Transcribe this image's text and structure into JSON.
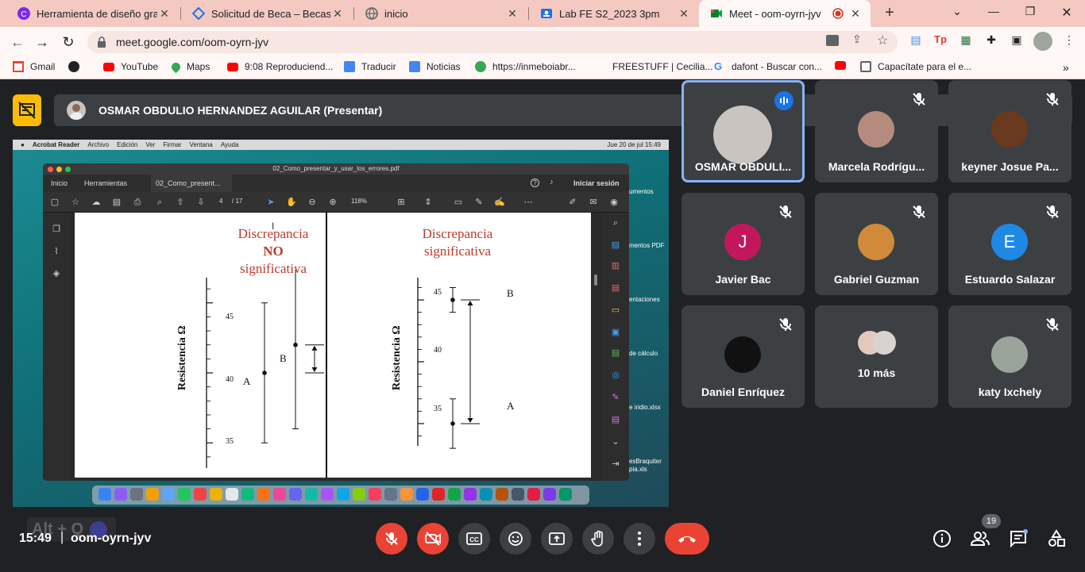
{
  "browser": {
    "tabs": [
      {
        "title": "Herramienta de diseño gratu",
        "icon": "canva-icon",
        "color": "#7d2ae8"
      },
      {
        "title": "Solicitud de Beca – Becas US",
        "icon": "diamond-icon",
        "color": "#1a73e8"
      },
      {
        "title": "inicio",
        "icon": "globe-icon",
        "color": "#5f6368"
      },
      {
        "title": "Lab FE S2_2023 3pm",
        "icon": "classroom-icon",
        "color": "#1a73e8"
      },
      {
        "title": "Meet - oom-oyrn-jyv",
        "icon": "meet-icon",
        "color": "#00832d",
        "active": true
      }
    ],
    "url": "meet.google.com/oom-oyrn-jyv",
    "bookmarks": [
      {
        "label": "Gmail",
        "icon": "gmail-icon",
        "color": "#ea4335"
      },
      {
        "label": "",
        "icon": "github-icon",
        "color": "#222"
      },
      {
        "label": "YouTube",
        "icon": "youtube-icon",
        "color": "#ff0000"
      },
      {
        "label": "Maps",
        "icon": "maps-icon",
        "color": "#34a853"
      },
      {
        "label": "9:08 Reproduciend...",
        "icon": "youtube-icon",
        "color": "#ff0000"
      },
      {
        "label": "Traducir",
        "icon": "translate-icon",
        "color": "#4285f4"
      },
      {
        "label": "Noticias",
        "icon": "news-icon",
        "color": "#4285f4"
      },
      {
        "label": "https://inmeboiabr...",
        "icon": "globe-icon",
        "color": "#34a853"
      },
      {
        "label": "FREESTUFF | Cecilia...",
        "icon": "",
        "color": "#fff7f5"
      },
      {
        "label": "dafont - Buscar con...",
        "icon": "google-icon",
        "color": "#4285f4"
      },
      {
        "label": "",
        "icon": "youtube-icon",
        "color": "#ff0000"
      },
      {
        "label": "Capacítate para el e...",
        "icon": "edit-icon",
        "color": "#5f6368"
      }
    ],
    "bookmarks_more": "»"
  },
  "meet": {
    "presenter": "OSMAR OBDULIO HERNANDEZ AGUILAR (Presentar)",
    "time": "15:49",
    "separator": "|",
    "code": "oom-oyrn-jyv",
    "shortcut_hint": "Alt + Q",
    "participants_count": "19",
    "participants": [
      {
        "name": "OSMAR OBDULI...",
        "speaking": true,
        "avatar": "photo",
        "color": "#c9c4bf"
      },
      {
        "name": "Marcela Rodrígu...",
        "avatar": "photo",
        "color": "#b58b7e"
      },
      {
        "name": "keyner Josue Pa...",
        "avatar": "photo",
        "color": "#6a3a1e"
      },
      {
        "name": "Javier Bac",
        "avatar": "J",
        "color": "#c2185b"
      },
      {
        "name": "Gabriel Guzman",
        "avatar": "photo",
        "color": "#d08a3a"
      },
      {
        "name": "Estuardo Salazar",
        "avatar": "E",
        "color": "#1e88e5"
      },
      {
        "name": "Daniel Enríquez",
        "avatar": "photo",
        "color": "#111"
      },
      {
        "name": "10 más",
        "avatar": "group",
        "color": "#c9a7a0"
      },
      {
        "name": "katy Ixchely",
        "avatar": "photo",
        "color": "#9aa49a"
      }
    ]
  },
  "shared_screen": {
    "mac_menu": [
      "Acrobat Reader",
      "Archivo",
      "Edición",
      "Ver",
      "Firmar",
      "Ventana",
      "Ayuda"
    ],
    "mac_clock": "Jue 20 de jul  15:49",
    "doc_title": "02_Como_presentar_y_usar_los_errores.pdf",
    "tabs": [
      "Inicio",
      "Herramientas",
      "02_Como_present..."
    ],
    "signin": "Iniciar sesión",
    "page_num": "4",
    "page_total": "/ 17",
    "zoom": "118%",
    "desktop_labels": [
      "umentos",
      "mentos PDF",
      "entaciones",
      "de cálculo",
      "e iridio.xlsx",
      "esBraquiter",
      "pia.xls"
    ],
    "chart_data": [
      {
        "type": "scatter",
        "title": [
          "Discrepancia",
          "NO",
          "significativa"
        ],
        "ylabel": "Resistencia  Ω",
        "yticks": [
          "45",
          "40",
          "35"
        ],
        "ylim": [
          35,
          45
        ],
        "points": [
          {
            "label": "A",
            "y": 40,
            "err": 5
          },
          {
            "label": "B",
            "y": 42,
            "err": 6
          }
        ],
        "difference_arrow": [
          40,
          42
        ]
      },
      {
        "type": "scatter",
        "title": [
          "Discrepancia",
          "significativa"
        ],
        "ylabel": "Resistencia  Ω",
        "yticks": [
          "45",
          "40",
          "35"
        ],
        "ylim": [
          35,
          45
        ],
        "points": [
          {
            "label": "B",
            "y": 45,
            "err": 1
          },
          {
            "label": "A",
            "y": 35,
            "err": 2
          }
        ],
        "difference_arrow": [
          35,
          45
        ]
      }
    ]
  }
}
